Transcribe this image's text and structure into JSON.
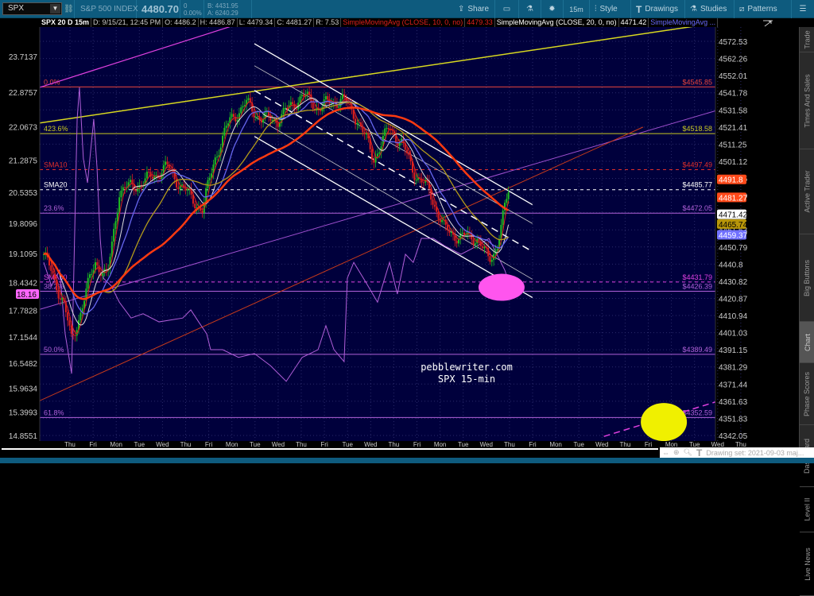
{
  "toolbar": {
    "symbol": "SPX",
    "description": "S&P 500 INDEX",
    "last": "4480.70",
    "change": "0",
    "change_pct": "0.00%",
    "bid": "B: 4431.95",
    "ask": "A: 6240.29",
    "share": "Share",
    "timeframe": "15m",
    "style": "Style",
    "drawings": "Drawings",
    "studies": "Studies",
    "patterns": "Patterns"
  },
  "infobar": {
    "title": "SPX 20 D 15m",
    "date": "D: 9/15/21, 12:45 PM",
    "open": "O: 4486.2",
    "high": "H: 4486.87",
    "low": "L: 4479.34",
    "close": "C: 4481.27",
    "range": "R: 7.53",
    "sma10_name": "SimpleMovingAvg (CLOSE, 10, 0, no)",
    "sma10_val": "4479.33",
    "sma20_name": "SimpleMovingAvg (CLOSE, 20, 0, no)",
    "sma20_val": "4471.42",
    "sma50_name": "SimpleMovingAvg ..."
  },
  "sidebar": [
    "Trade",
    "Times And Sales",
    "Active Trader",
    "Big Buttons",
    "Chart",
    "Phase Scores",
    "Dashboard",
    "Level II",
    "Live News"
  ],
  "bottom": {
    "drawing_set": "Drawing set: 2021-09-03 maj..."
  },
  "watermark": [
    "pebblewriter.com",
    "SPX 15-min"
  ],
  "colors": {
    "bg": "#00003c",
    "up": "#1fbf1f",
    "down": "#e0201c",
    "sma_fast": "#e0201c",
    "sma_white": "#dddddd",
    "sma_blue": "#6666ee",
    "sma_yellow": "#b39a1a",
    "sma_red": "#ff3a10",
    "vix": "#b05ed8"
  },
  "chart_data": {
    "type": "line",
    "title": "SPX 20 D 15m",
    "x_unit": "trading sessions",
    "x_ticks": [
      "Thu",
      "Fri",
      "Mon",
      "Tue",
      "Wed",
      "Thu",
      "Fri",
      "Mon",
      "Tue",
      "Wed",
      "Thu",
      "Fri",
      "Tue",
      "Wed",
      "Thu",
      "Fri",
      "Mon",
      "Tue",
      "Wed",
      "Thu",
      "Fri",
      "Mon",
      "Tue",
      "Wed",
      "Thu",
      "Fri",
      "Mon",
      "Tue",
      "Wed",
      "Thu"
    ],
    "right_axis": {
      "label": "SPX",
      "ylim": [
        4342.05,
        4572.53
      ],
      "ticks": [
        "4572.53",
        "4562.26",
        "4552.01",
        "4541.78",
        "4531.58",
        "4521.41",
        "4511.25",
        "4501.12",
        "4491.15",
        "4481.29",
        "4471.44",
        "4461.63",
        "4450.79",
        "4440.8",
        "4430.82",
        "4420.87",
        "4410.94",
        "4401.03",
        "4391.15",
        "4381.29",
        "4371.44",
        "4361.63",
        "4351.83",
        "4342.05"
      ]
    },
    "left_axis": {
      "label": "VIX",
      "ylim": [
        14.8551,
        23.7137
      ],
      "ticks": [
        "23.7137",
        "22.8757",
        "22.0673",
        "21.2875",
        "20.5353",
        "19.8096",
        "19.1095",
        "18.4342",
        "17.7828",
        "17.1544",
        "16.5482",
        "15.9634",
        "15.3993",
        "14.8551"
      ]
    },
    "price": {
      "x": [
        0,
        0.86,
        1.21,
        1.72,
        2.24,
        2.76,
        3.28,
        4.31,
        5.34,
        6.38,
        6.9,
        7.41,
        8.1,
        8.79,
        9.48,
        10.17,
        11.21,
        11.9,
        12.93,
        13.62,
        14.31,
        15,
        15.52,
        16.03,
        16.72,
        17.41,
        18.1,
        18.79,
        19.31,
        19.66,
        20.17
      ],
      "close": [
        4448,
        4420,
        4397,
        4420,
        4444,
        4434,
        4485,
        4490,
        4499,
        4481,
        4474,
        4504,
        4527,
        4536,
        4527,
        4527,
        4541,
        4534,
        4539,
        4527,
        4504,
        4522,
        4513,
        4497,
        4485,
        4462,
        4458,
        4458,
        4444,
        4453,
        4485
      ]
    },
    "vix": {
      "x": [
        0,
        0.34,
        0.69,
        0.93,
        1.21,
        1.45,
        1.55,
        1.72,
        1.9,
        2.17,
        2.31,
        2.45,
        2.59,
        2.93,
        3.28,
        3.79,
        4.31,
        5,
        6.03,
        6.38,
        6.72,
        7.07,
        7.24,
        7.76,
        8.45,
        9.14,
        9.83,
        10.52,
        11.21,
        11.9,
        12.24,
        12.59,
        13.03,
        13.17,
        13.45,
        13.97,
        14.48,
        15,
        15.34,
        15.69,
        16.03,
        16.38,
        16.9,
        17.41,
        18.1,
        18.79,
        19.31,
        19.66,
        20.0,
        20.24
      ],
      "values": [
        18.9,
        18.35,
        18.72,
        17.23,
        16.3,
        22.25,
        22.99,
        21.32,
        20.76,
        22.25,
        21.13,
        19.46,
        18.53,
        18.35,
        17.97,
        17.6,
        17.7,
        17.51,
        17.6,
        17.79,
        17.51,
        17.23,
        16.86,
        16.86,
        16.68,
        16.77,
        16.49,
        16.12,
        16.68,
        16.86,
        17.42,
        16.86,
        16.58,
        18.53,
        18.9,
        18.44,
        17.97,
        18.9,
        18.16,
        19.09,
        18.9,
        19.46,
        19.46,
        19.28,
        19.09,
        19.28,
        19.46,
        19.09,
        18.72,
        18.35
      ]
    },
    "levels": [
      {
        "label": "0.0%",
        "value": 4545.85,
        "text": "$4545.85",
        "color": "#e8453c",
        "dash": false
      },
      {
        "label": "423.6%",
        "value": 4518.58,
        "text": "$4518.58",
        "color": "#c8c820",
        "dash": false
      },
      {
        "label": "SMA10",
        "value": 4497.49,
        "text": "$4497.49",
        "color": "#e0302b",
        "dash": true
      },
      {
        "label": "SMA20",
        "value": 4485.77,
        "text": "$4485.77",
        "color": "#ffffff",
        "dash": true
      },
      {
        "label": "23.6%",
        "value": 4472.05,
        "text": "$4472.05",
        "color": "#b060d8",
        "dash": false
      },
      {
        "label": "SMA50",
        "value": 4431.79,
        "text": "$4431.79",
        "color": "#e040e0",
        "dash": true
      },
      {
        "label": "38.2%",
        "value": 4426.39,
        "text": "$4426.39",
        "color": "#b060d8",
        "dash": false
      },
      {
        "label": "50.0%",
        "value": 4389.49,
        "text": "$4389.49",
        "color": "#b060d8",
        "dash": false
      },
      {
        "label": "61.8%",
        "value": 4352.59,
        "text": "$4352.59",
        "color": "#b060d8",
        "dash": false
      }
    ],
    "price_badges": [
      {
        "text": "4491.8",
        "value": 4491.8,
        "bg": "#ff4a1a",
        "fg": "#fff"
      },
      {
        "text": "4481.27",
        "value": 4481.27,
        "bg": "#ff4a1a",
        "fg": "#fff"
      },
      {
        "text": "4471.42",
        "value": 4471.42,
        "bg": "#ffffff",
        "fg": "#000"
      },
      {
        "text": "4465.74",
        "value": 4465.74,
        "bg": "#b8960a",
        "fg": "#000"
      },
      {
        "text": "4459.37",
        "value": 4459.37,
        "bg": "#7070ff",
        "fg": "#fff"
      }
    ],
    "vix_badge": {
      "text": "18.16",
      "value": 18.16
    },
    "trendlines": [
      {
        "name": "yellow-trendline",
        "p1": [
          -0.17,
          4524.8
        ],
        "p2": [
          28.45,
          4581.8
        ],
        "color": "#d8d820",
        "width": 1.5,
        "dash": ""
      },
      {
        "name": "magenta-trendline",
        "p1": [
          -0.17,
          4545.6
        ],
        "p2": [
          8.45,
          4582.7
        ],
        "color": "#e040e0",
        "width": 1.2,
        "dash": ""
      },
      {
        "name": "purple-trendline",
        "p1": [
          -0.17,
          4415.8
        ],
        "p2": [
          32.6,
          4545.6
        ],
        "color": "#a050d0",
        "width": 1,
        "dash": ""
      },
      {
        "name": "orange-trendline",
        "p1": [
          -0.17,
          4362.4
        ],
        "p2": [
          26,
          4522.4
        ],
        "color": "#c83a1a",
        "width": 1,
        "dash": ""
      },
      {
        "name": "magenta-dashed-trendline",
        "p1": [
          24.3,
          4341.5
        ],
        "p2": [
          31,
          4369.4
        ],
        "color": "#e040e0",
        "width": 1.5,
        "dash": "8 5"
      },
      {
        "name": "channel-top",
        "p1": [
          9.14,
          4571.1
        ],
        "p2": [
          21.2,
          4477.0
        ],
        "color": "#ffffff",
        "width": 1.3,
        "dash": ""
      },
      {
        "name": "channel-upper-mid",
        "p1": [
          9.14,
          4558.2
        ],
        "p2": [
          21.2,
          4466.0
        ],
        "color": "#cccccc",
        "width": 0.8,
        "dash": ""
      },
      {
        "name": "channel-center",
        "p1": [
          9.14,
          4543.8
        ],
        "p2": [
          21.2,
          4449.6
        ],
        "color": "#ffffff",
        "width": 1.5,
        "dash": "9 6"
      },
      {
        "name": "channel-lower-mid",
        "p1": [
          9.14,
          4528.5
        ],
        "p2": [
          21.2,
          4433.4
        ],
        "color": "#cccccc",
        "width": 0.8,
        "dash": ""
      },
      {
        "name": "channel-bottom",
        "p1": [
          9.14,
          4516.9
        ],
        "p2": [
          21.2,
          4422.7
        ],
        "color": "#ffffff",
        "width": 1.3,
        "dash": ""
      }
    ],
    "ellipses": [
      {
        "name": "pink-target-ellipse",
        "center": [
          19.86,
          4428.7
        ],
        "color": "#ff55ee"
      },
      {
        "name": "yellow-target-ellipse",
        "center": [
          26.9,
          4349.9
        ],
        "color": "#f0f000"
      }
    ]
  }
}
